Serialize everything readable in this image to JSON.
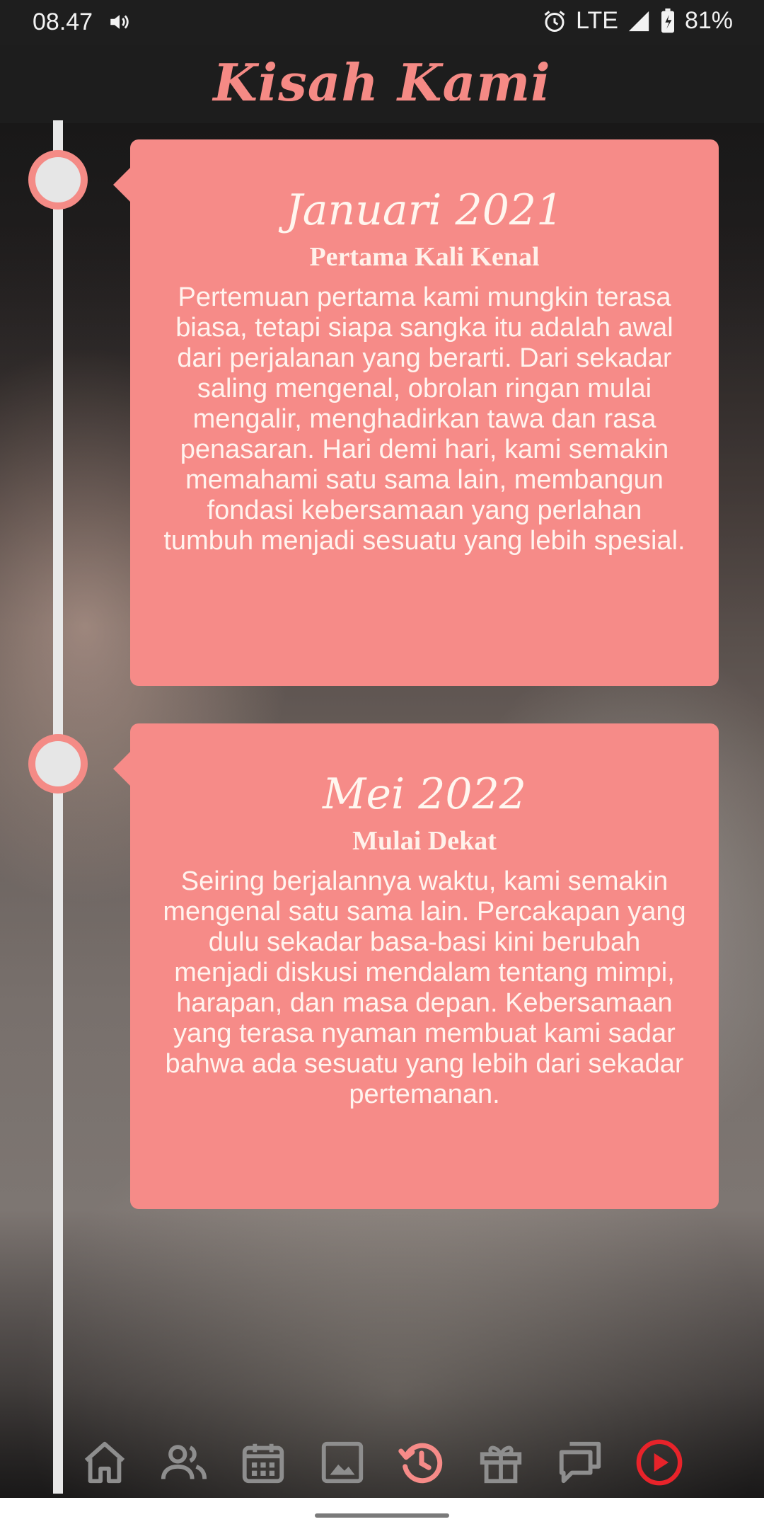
{
  "status_bar": {
    "time": "08.47",
    "network": "LTE",
    "battery": "81%"
  },
  "header": {
    "title": "Kisah Kami"
  },
  "timeline": [
    {
      "date": "Januari 2021",
      "subtitle": "Pertama Kali Kenal",
      "body": "Pertemuan pertama kami mungkin terasa biasa, tetapi siapa sangka itu adalah awal dari perjalanan yang berarti. Dari sekadar saling mengenal, obrolan ringan mulai mengalir, menghadirkan tawa dan rasa penasaran. Hari demi hari, kami semakin memahami satu sama lain, membangun fondasi kebersamaan yang perlahan tumbuh menjadi sesuatu yang lebih spesial."
    },
    {
      "date": "Mei 2022",
      "subtitle": "Mulai Dekat",
      "body": "Seiring berjalannya waktu, kami semakin mengenal satu sama lain. Percakapan yang dulu sekadar basa-basi kini berubah menjadi diskusi mendalam tentang mimpi, harapan, dan masa depan. Kebersamaan yang terasa nyaman membuat kami sadar bahwa ada sesuatu yang lebih dari sekadar pertemanan."
    }
  ],
  "bottom_nav": {
    "items": [
      {
        "icon": "home-icon",
        "active": false
      },
      {
        "icon": "people-icon",
        "active": false
      },
      {
        "icon": "calendar-icon",
        "active": false
      },
      {
        "icon": "gallery-icon",
        "active": false
      },
      {
        "icon": "history-icon",
        "active": true
      },
      {
        "icon": "gift-icon",
        "active": false
      },
      {
        "icon": "chat-icon",
        "active": false
      },
      {
        "icon": "play-icon",
        "active": false
      }
    ]
  },
  "colors": {
    "accent": "#f68b88",
    "play": "#e8232a",
    "nav_icon": "#8e8e8e"
  }
}
